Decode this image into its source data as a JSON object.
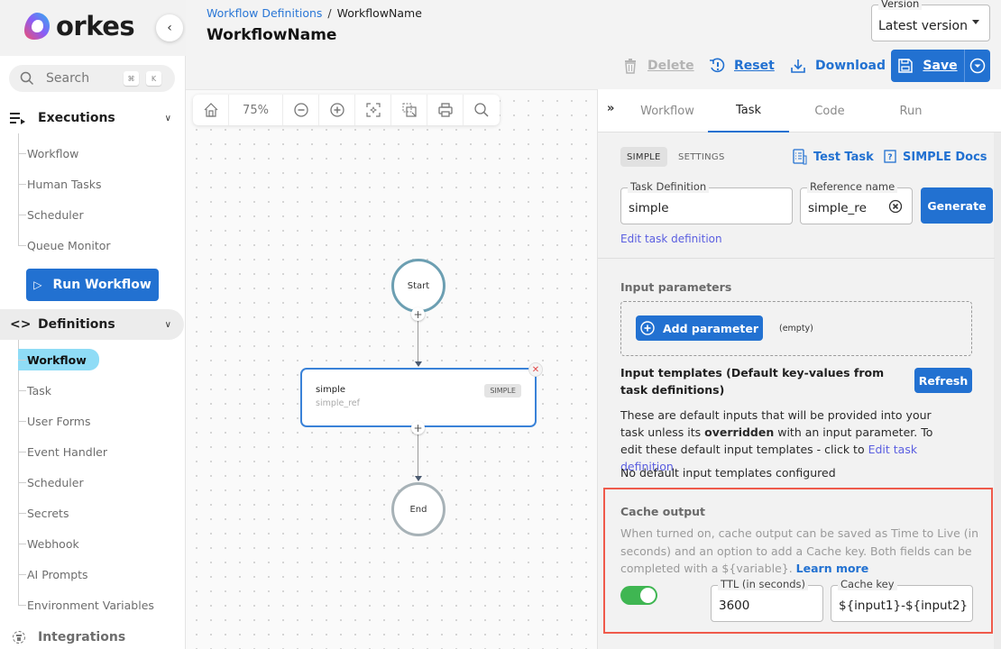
{
  "brand": {
    "name": "orkes",
    "accent": "#2271d1"
  },
  "sidebar": {
    "search_placeholder": "Search",
    "shortcut": [
      "⌘",
      "K"
    ],
    "executions": {
      "label": "Executions",
      "items": [
        "Workflow",
        "Human Tasks",
        "Scheduler",
        "Queue Monitor"
      ]
    },
    "run_workflow_label": "Run Workflow",
    "definitions": {
      "label": "Definitions",
      "selected": "Workflow",
      "items": [
        "Workflow",
        "Task",
        "User Forms",
        "Event Handler",
        "Scheduler",
        "Secrets",
        "Webhook",
        "AI Prompts",
        "Environment Variables"
      ]
    },
    "integrations_label": "Integrations"
  },
  "header": {
    "breadcrumb": {
      "parent": "Workflow Definitions",
      "separator": "/",
      "current": "WorkflowName"
    },
    "title": "WorkflowName",
    "version": {
      "label": "Version",
      "value": "Latest version"
    },
    "actions": {
      "delete": "Delete",
      "reset": "Reset",
      "download": "Download",
      "save": "Save"
    }
  },
  "canvas": {
    "zoom": "75%",
    "toolbar_icons": [
      "home-icon",
      "zoom-out-icon",
      "zoom-in-icon",
      "fit-view-icon",
      "select-area-icon",
      "print-icon",
      "search-icon"
    ],
    "nodes": {
      "start": "Start",
      "end": "End",
      "task": {
        "name": "simple",
        "ref": "simple_ref",
        "type": "SIMPLE"
      }
    }
  },
  "panel": {
    "tabs": [
      "Workflow",
      "Task",
      "Code",
      "Run"
    ],
    "active_tab": "Task",
    "subtabs": [
      "SIMPLE",
      "SETTINGS"
    ],
    "test_task": "Test Task",
    "docs": "SIMPLE Docs",
    "task_definition": {
      "label": "Task Definition",
      "value": "simple"
    },
    "reference_name": {
      "label": "Reference name",
      "value": "simple_re"
    },
    "generate_label": "Generate",
    "edit_task_definition": "Edit task definition",
    "input_parameters": {
      "title": "Input parameters",
      "add_label": "Add parameter",
      "empty_label": "(empty)"
    },
    "input_templates": {
      "title": "Input templates (Default key-values from task definitions)",
      "refresh_label": "Refresh",
      "desc_part1": "These are default inputs that will be provided into your task unless its ",
      "desc_bold": "overridden",
      "desc_part2": " with an input parameter. To edit these default input templates - click to ",
      "desc_link": "Edit task definition",
      "none": "No default input templates configured"
    },
    "cache_output": {
      "title": "Cache output",
      "desc": "When turned on, cache output can be saved as Time to Live (in seconds) and an option to add a Cache key. Both fields can be completed with a ${variable}. ",
      "learn_more": "Learn more",
      "enabled": true,
      "ttl": {
        "label": "TTL (in seconds)",
        "value": "3600"
      },
      "cache_key": {
        "label": "Cache key",
        "value": "${input1}-${input2}"
      },
      "highlight_color": "#ef5a4b"
    }
  }
}
